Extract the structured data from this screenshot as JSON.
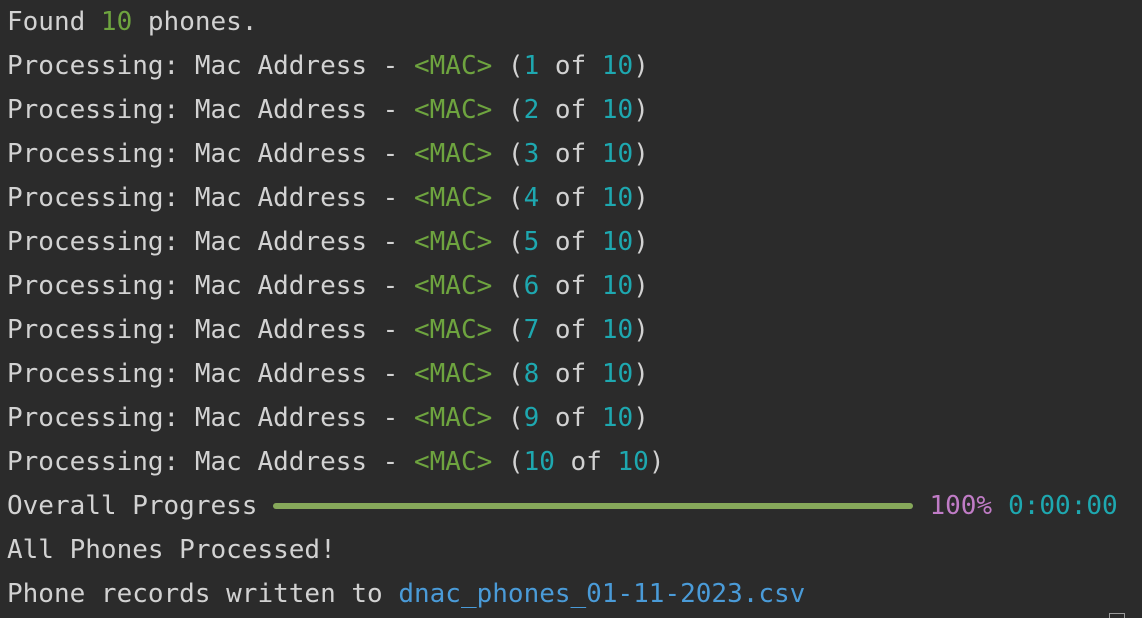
{
  "found": {
    "prefix": "Found ",
    "count": "10",
    "suffix": " phones."
  },
  "processing": {
    "label": "Processing: Mac Address - ",
    "mac": "<MAC>",
    "open": " (",
    "of": " of ",
    "close": ")",
    "total": "10",
    "indices": [
      "1",
      "2",
      "3",
      "4",
      "5",
      "6",
      "7",
      "8",
      "9",
      "10"
    ]
  },
  "progress": {
    "label": "Overall Progress",
    "percent_text": "100%",
    "elapsed": "0:00:00",
    "fill_fraction": 1.0
  },
  "done_message": "All Phones Processed!",
  "written": {
    "prefix": "Phone records written to ",
    "filename": "dnac_phones_01-11-2023.csv"
  },
  "colors": {
    "background": "#2b2b2b",
    "text": "#d2d2d2",
    "green": "#6ea43f",
    "cyan": "#1ea8b0",
    "purple": "#c07cc6",
    "blue": "#4a9bd8",
    "bar": "#86a85a"
  }
}
